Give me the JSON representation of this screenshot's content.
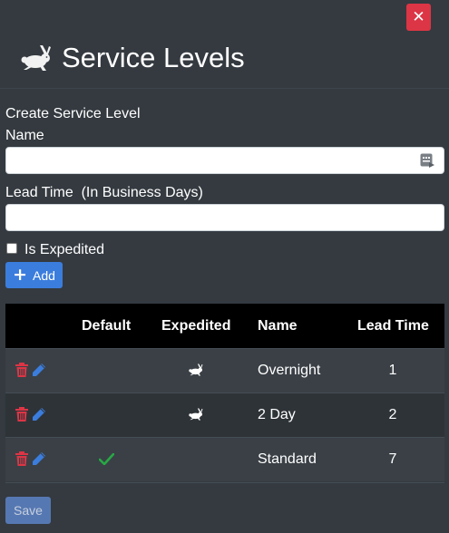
{
  "dialog": {
    "close_label": "✕",
    "title": "Service Levels",
    "title_icon": "rabbit-icon"
  },
  "form": {
    "section_title": "Create Service Level",
    "name_label": "Name",
    "name_value": "",
    "name_icon": "autofill-icon",
    "lead_time_label": "Lead Time  (In Business Days)",
    "lead_time_value": "",
    "expedited_label": "Is Expedited",
    "expedited_checked": false,
    "add_label": "Add",
    "add_icon": "plus-icon"
  },
  "table": {
    "headers": [
      "",
      "Default",
      "Expedited",
      "Name",
      "Lead Time"
    ],
    "rows": [
      {
        "is_default": false,
        "is_expedited": true,
        "name": "Overnight",
        "lead_time": "1"
      },
      {
        "is_default": false,
        "is_expedited": true,
        "name": "2 Day",
        "lead_time": "2"
      },
      {
        "is_default": true,
        "is_expedited": false,
        "name": "Standard",
        "lead_time": "7"
      }
    ]
  },
  "footer": {
    "save_label": "Save"
  },
  "colors": {
    "background": "#343a40",
    "close_button": "#dc3545",
    "primary_button": "#3b7ddd",
    "delete_icon": "#dc3545",
    "edit_icon": "#3b7ddd",
    "check_icon": "#28a745"
  }
}
